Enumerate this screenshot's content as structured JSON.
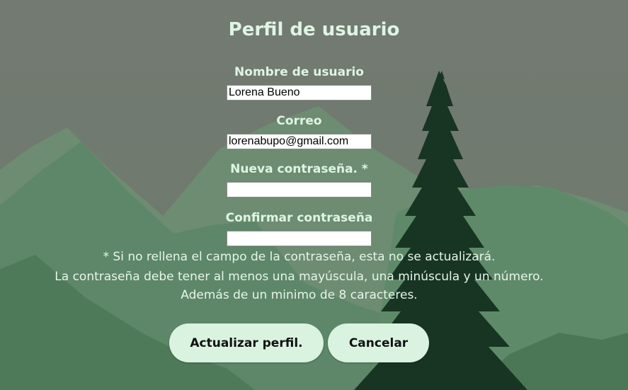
{
  "page": {
    "title": "Perfil de usuario"
  },
  "form": {
    "username_label": "Nombre de usuario",
    "username_value": "Lorena Bueno",
    "email_label": "Correo",
    "email_value": "lorenabupo@gmail.com",
    "new_password_label": "Nueva contraseña. *",
    "new_password_value": "",
    "confirm_password_label": "Confirmar contraseña",
    "confirm_password_value": ""
  },
  "notes": {
    "line1": "* Si no rellena el campo de la contraseña, esta no se actualizará.",
    "line2": "La contraseña debe tener al menos una mayúscula, una minúscula y un número.",
    "line3": "Además de un minimo de 8 caracteres."
  },
  "actions": {
    "update_label": "Actualizar perfil.",
    "cancel_label": "Cancelar"
  },
  "colors": {
    "background": "#6f7d70",
    "text_accent": "#dff5e4",
    "button_bg": "#d9f3e0"
  }
}
